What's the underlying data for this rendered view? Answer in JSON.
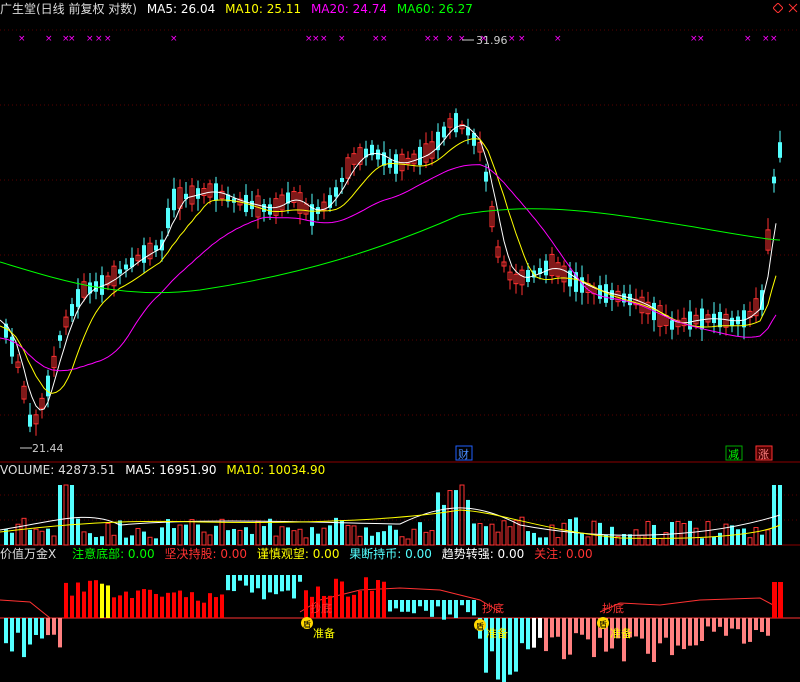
{
  "main_panel": {
    "title": "广生堂(日线 前复权 对数)",
    "ma5_label": "MA5: 26.04",
    "ma10_label": "MA10: 25.11",
    "ma20_label": "MA20: 24.74",
    "ma60_label": "MA60: 26.27",
    "high_marker": "31.96",
    "low_marker": "21.44",
    "flag_cai": "财",
    "flag_jian": "减",
    "flag_zhang": "涨",
    "colors": {
      "ma5": "#ffffff",
      "ma10": "#ffff00",
      "ma20": "#ff00ff",
      "ma60": "#00ff00",
      "up": "#ff3232",
      "down": "#54ffff"
    }
  },
  "volume_panel": {
    "title": "VOLUME: 42873.51",
    "ma5_label": "MA5: 16951.90",
    "ma10_label": "MA10: 10034.90"
  },
  "indicator_panel": {
    "title": "价值万金X",
    "items": [
      {
        "label": "注意底部: 0.00",
        "color": "#00ff00"
      },
      {
        "label": "坚决持股: 0.00",
        "color": "#ff3232"
      },
      {
        "label": "谨慎观望: 0.00",
        "color": "#ffff00"
      },
      {
        "label": "果断持币: 0.00",
        "color": "#54ffff"
      },
      {
        "label": "趋势转强: 0.00",
        "color": "#ffffff"
      },
      {
        "label": "关注: 0.00",
        "color": "#ff3232"
      }
    ],
    "signals": [
      {
        "top": "抄底",
        "bottom": "准备",
        "icon": "盾"
      },
      {
        "top": "抄底",
        "bottom": "准备",
        "icon": "盾"
      },
      {
        "top": "抄底",
        "bottom": "准备",
        "icon": "盾"
      }
    ]
  }
}
